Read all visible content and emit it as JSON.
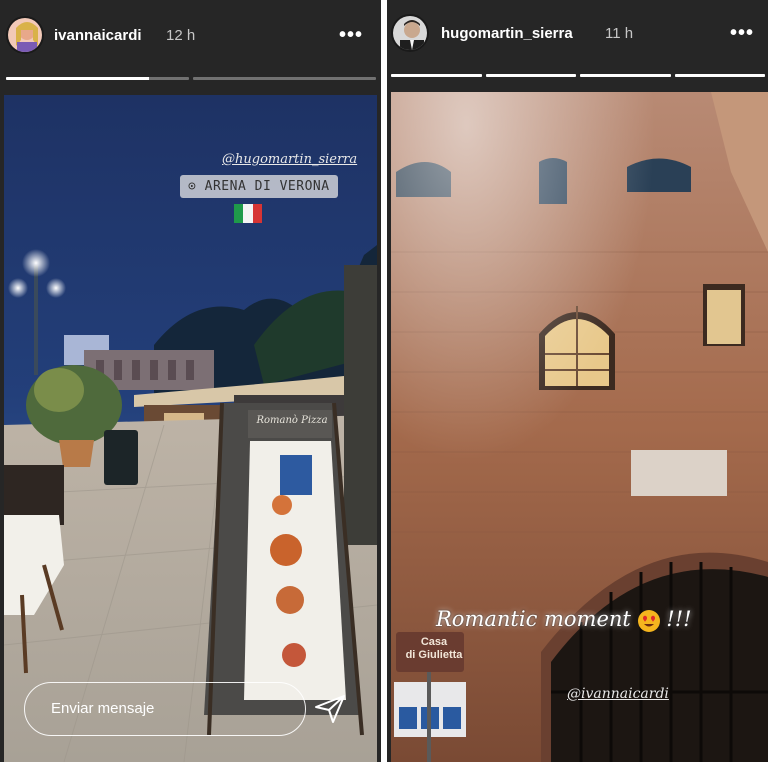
{
  "left_story": {
    "username": "ivannaicardi",
    "time": "12 h",
    "more_icon": "more-horizontal-icon",
    "progress": [
      0.78,
      0
    ],
    "mention": "@hugomartin_sierra",
    "location": "ARENA DI VERONA",
    "flag_icon": "italy-flag-icon",
    "sign_heading": "Romanò Pizza",
    "reply_placeholder": "Enviar mensaje",
    "send_icon": "paper-plane-icon"
  },
  "right_story": {
    "username": "hugomartin_sierra",
    "time": "11 h",
    "more_icon": "more-horizontal-icon",
    "progress": [
      1,
      1,
      1,
      1
    ],
    "caption": "Romantic moment",
    "caption_suffix": "!!!",
    "emoji_icon": "heart-eyes-emoji-icon",
    "mention": "@ivannaicardi",
    "sign_line1": "Casa",
    "sign_line2": "di Giulietta"
  },
  "colors": {
    "panel_bg": "#262626",
    "progress_track": "rgba(255,255,255,0.35)",
    "progress_fill": "#ffffff"
  }
}
